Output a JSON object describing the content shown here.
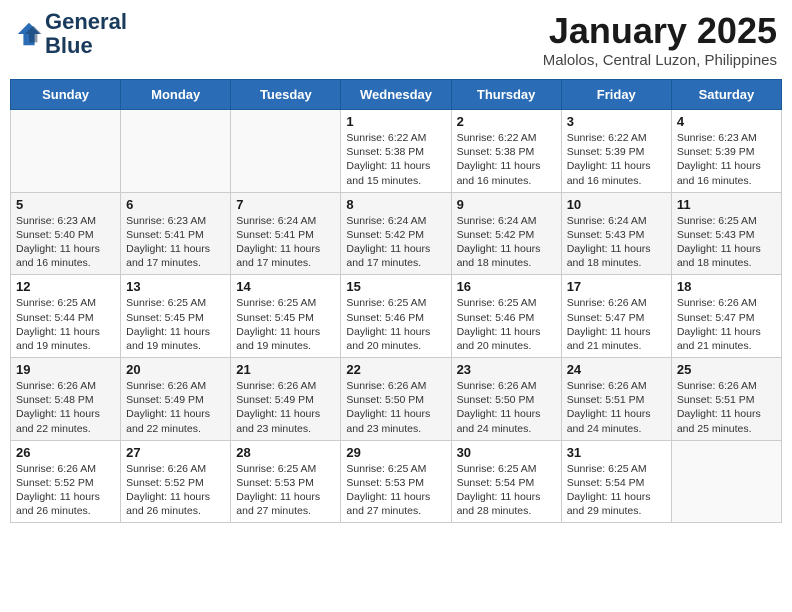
{
  "header": {
    "logo_line1": "General",
    "logo_line2": "Blue",
    "month_title": "January 2025",
    "location": "Malolos, Central Luzon, Philippines"
  },
  "weekdays": [
    "Sunday",
    "Monday",
    "Tuesday",
    "Wednesday",
    "Thursday",
    "Friday",
    "Saturday"
  ],
  "weeks": [
    [
      {
        "day": "",
        "info": ""
      },
      {
        "day": "",
        "info": ""
      },
      {
        "day": "",
        "info": ""
      },
      {
        "day": "1",
        "info": "Sunrise: 6:22 AM\nSunset: 5:38 PM\nDaylight: 11 hours and 15 minutes."
      },
      {
        "day": "2",
        "info": "Sunrise: 6:22 AM\nSunset: 5:38 PM\nDaylight: 11 hours and 16 minutes."
      },
      {
        "day": "3",
        "info": "Sunrise: 6:22 AM\nSunset: 5:39 PM\nDaylight: 11 hours and 16 minutes."
      },
      {
        "day": "4",
        "info": "Sunrise: 6:23 AM\nSunset: 5:39 PM\nDaylight: 11 hours and 16 minutes."
      }
    ],
    [
      {
        "day": "5",
        "info": "Sunrise: 6:23 AM\nSunset: 5:40 PM\nDaylight: 11 hours and 16 minutes."
      },
      {
        "day": "6",
        "info": "Sunrise: 6:23 AM\nSunset: 5:41 PM\nDaylight: 11 hours and 17 minutes."
      },
      {
        "day": "7",
        "info": "Sunrise: 6:24 AM\nSunset: 5:41 PM\nDaylight: 11 hours and 17 minutes."
      },
      {
        "day": "8",
        "info": "Sunrise: 6:24 AM\nSunset: 5:42 PM\nDaylight: 11 hours and 17 minutes."
      },
      {
        "day": "9",
        "info": "Sunrise: 6:24 AM\nSunset: 5:42 PM\nDaylight: 11 hours and 18 minutes."
      },
      {
        "day": "10",
        "info": "Sunrise: 6:24 AM\nSunset: 5:43 PM\nDaylight: 11 hours and 18 minutes."
      },
      {
        "day": "11",
        "info": "Sunrise: 6:25 AM\nSunset: 5:43 PM\nDaylight: 11 hours and 18 minutes."
      }
    ],
    [
      {
        "day": "12",
        "info": "Sunrise: 6:25 AM\nSunset: 5:44 PM\nDaylight: 11 hours and 19 minutes."
      },
      {
        "day": "13",
        "info": "Sunrise: 6:25 AM\nSunset: 5:45 PM\nDaylight: 11 hours and 19 minutes."
      },
      {
        "day": "14",
        "info": "Sunrise: 6:25 AM\nSunset: 5:45 PM\nDaylight: 11 hours and 19 minutes."
      },
      {
        "day": "15",
        "info": "Sunrise: 6:25 AM\nSunset: 5:46 PM\nDaylight: 11 hours and 20 minutes."
      },
      {
        "day": "16",
        "info": "Sunrise: 6:25 AM\nSunset: 5:46 PM\nDaylight: 11 hours and 20 minutes."
      },
      {
        "day": "17",
        "info": "Sunrise: 6:26 AM\nSunset: 5:47 PM\nDaylight: 11 hours and 21 minutes."
      },
      {
        "day": "18",
        "info": "Sunrise: 6:26 AM\nSunset: 5:47 PM\nDaylight: 11 hours and 21 minutes."
      }
    ],
    [
      {
        "day": "19",
        "info": "Sunrise: 6:26 AM\nSunset: 5:48 PM\nDaylight: 11 hours and 22 minutes."
      },
      {
        "day": "20",
        "info": "Sunrise: 6:26 AM\nSunset: 5:49 PM\nDaylight: 11 hours and 22 minutes."
      },
      {
        "day": "21",
        "info": "Sunrise: 6:26 AM\nSunset: 5:49 PM\nDaylight: 11 hours and 23 minutes."
      },
      {
        "day": "22",
        "info": "Sunrise: 6:26 AM\nSunset: 5:50 PM\nDaylight: 11 hours and 23 minutes."
      },
      {
        "day": "23",
        "info": "Sunrise: 6:26 AM\nSunset: 5:50 PM\nDaylight: 11 hours and 24 minutes."
      },
      {
        "day": "24",
        "info": "Sunrise: 6:26 AM\nSunset: 5:51 PM\nDaylight: 11 hours and 24 minutes."
      },
      {
        "day": "25",
        "info": "Sunrise: 6:26 AM\nSunset: 5:51 PM\nDaylight: 11 hours and 25 minutes."
      }
    ],
    [
      {
        "day": "26",
        "info": "Sunrise: 6:26 AM\nSunset: 5:52 PM\nDaylight: 11 hours and 26 minutes."
      },
      {
        "day": "27",
        "info": "Sunrise: 6:26 AM\nSunset: 5:52 PM\nDaylight: 11 hours and 26 minutes."
      },
      {
        "day": "28",
        "info": "Sunrise: 6:25 AM\nSunset: 5:53 PM\nDaylight: 11 hours and 27 minutes."
      },
      {
        "day": "29",
        "info": "Sunrise: 6:25 AM\nSunset: 5:53 PM\nDaylight: 11 hours and 27 minutes."
      },
      {
        "day": "30",
        "info": "Sunrise: 6:25 AM\nSunset: 5:54 PM\nDaylight: 11 hours and 28 minutes."
      },
      {
        "day": "31",
        "info": "Sunrise: 6:25 AM\nSunset: 5:54 PM\nDaylight: 11 hours and 29 minutes."
      },
      {
        "day": "",
        "info": ""
      }
    ]
  ]
}
